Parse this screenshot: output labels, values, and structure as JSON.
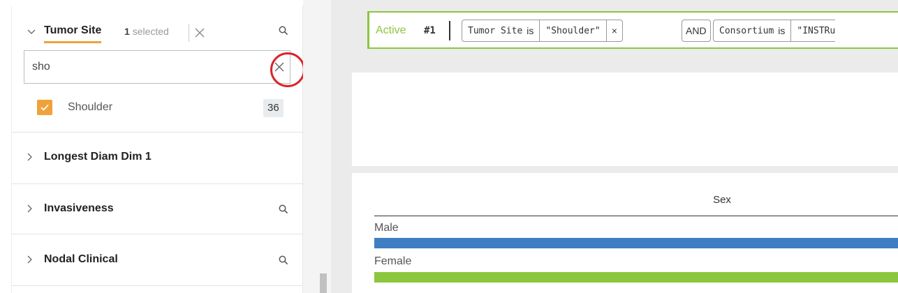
{
  "sidebar": {
    "facets": [
      {
        "title": "Tumor Site",
        "count_num": "1",
        "count_text": "selected",
        "expanded": true
      },
      {
        "title": "Longest Diam Dim 1",
        "expanded": false
      },
      {
        "title": "Invasiveness",
        "expanded": false
      },
      {
        "title": "Nodal Clinical",
        "expanded": false
      }
    ],
    "search": {
      "value": "sho"
    },
    "options": [
      {
        "label": "Shoulder",
        "count": "36",
        "checked": true
      }
    ]
  },
  "query": {
    "status": "Active",
    "number": "#1",
    "filters": [
      {
        "field": "Tumor Site",
        "op": "is",
        "value": "\"Shoulder\"",
        "remove": "×"
      },
      {
        "connector": "AND"
      },
      {
        "field": "Consortium",
        "op": "is",
        "value": "\"INSTRu"
      }
    ]
  },
  "chart_data": {
    "type": "bar",
    "title": "Sex",
    "categories": [
      "Male",
      "Female"
    ],
    "colors": [
      "#3f7ec2",
      "#8cc63f"
    ]
  },
  "icons": {
    "chevron_down": "chevron-down-icon",
    "chevron_right": "chevron-right-icon",
    "search": "search-icon",
    "close": "close-icon",
    "check": "check-icon"
  },
  "colors": {
    "accent": "#e8a33d",
    "active": "#8cc63f",
    "male": "#3f7ec2",
    "female": "#8cc63f",
    "highlight": "#d9252a"
  }
}
